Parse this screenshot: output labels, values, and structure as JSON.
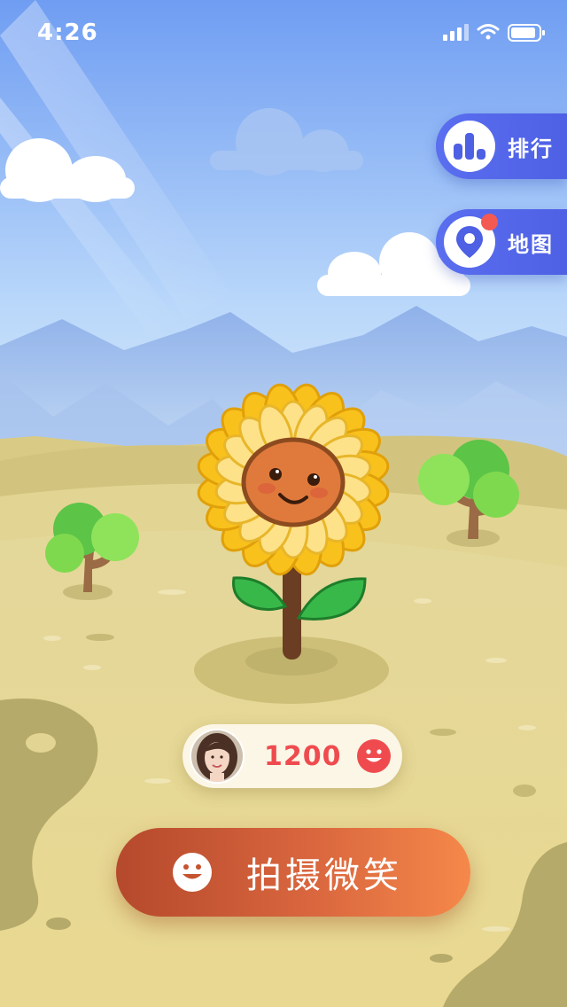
{
  "status_bar": {
    "time": "4:26",
    "battery_percent": 90
  },
  "side_menu": [
    {
      "id": "ranking",
      "label": "排行",
      "icon": "bar-chart-icon"
    },
    {
      "id": "map",
      "label": "地图",
      "icon": "map-pin-icon",
      "has_notification": true
    }
  ],
  "score": {
    "value": "1200",
    "icon": "smile-face-icon"
  },
  "capture_button": {
    "label": "拍摄微笑",
    "icon": "smile-face-icon"
  },
  "colors": {
    "sky_top": "#6f9df2",
    "accent_blue": "#5a6ef0",
    "score_red": "#ef4b4f",
    "button_start": "#b5492c",
    "button_end": "#f5884a"
  }
}
